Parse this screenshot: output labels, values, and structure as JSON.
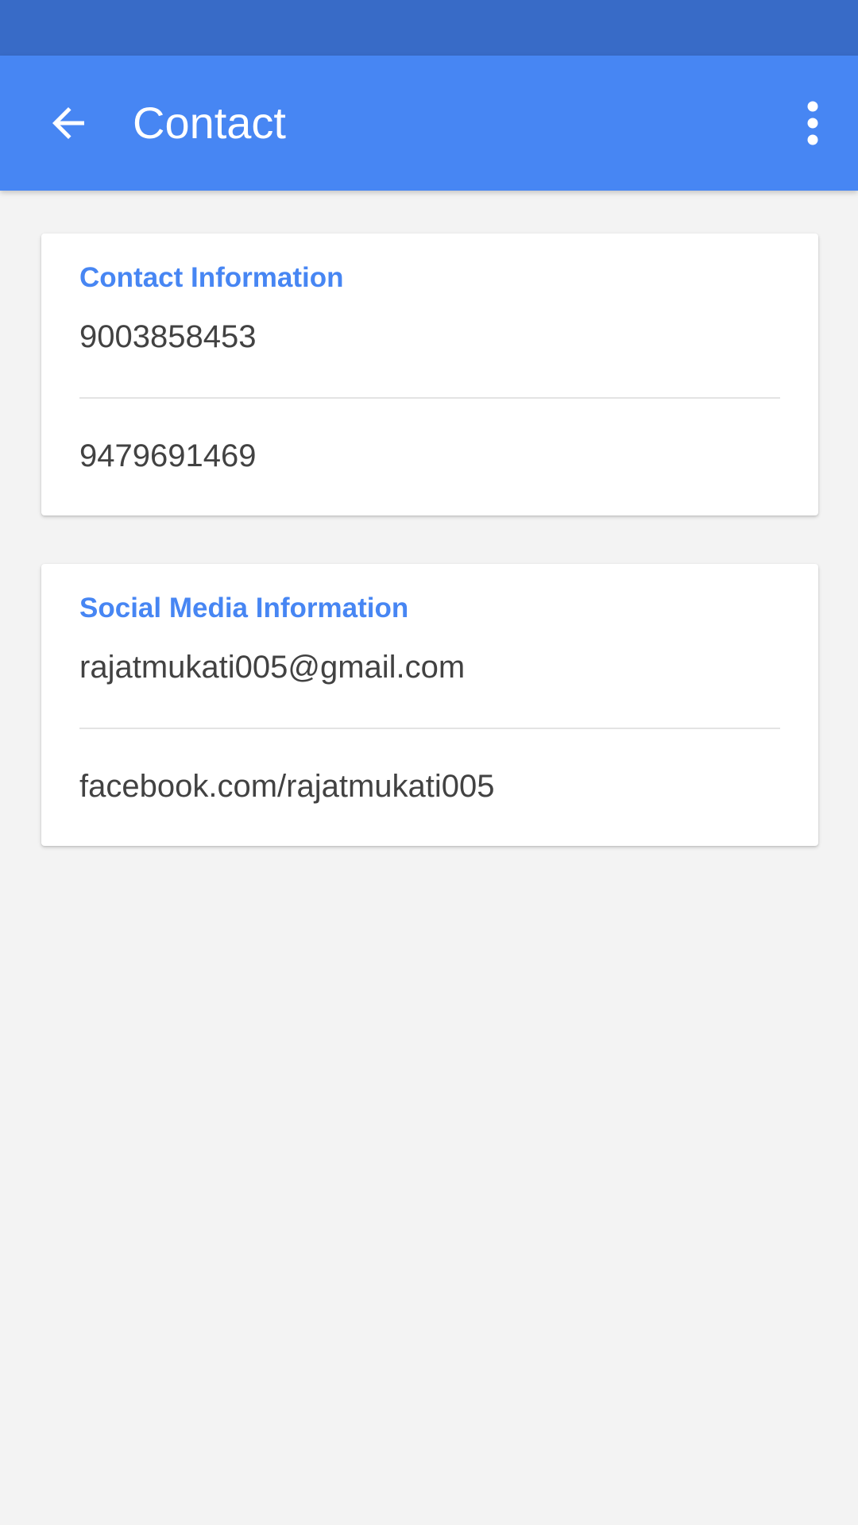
{
  "app_bar": {
    "title": "Contact",
    "back_icon": "arrow-back-icon",
    "overflow_icon": "more-vert-icon",
    "color": "#4786f3",
    "status_bar_color": "#386bc7"
  },
  "contact_card": {
    "heading": "Contact Information",
    "phone_1": "9003858453",
    "phone_2": "9479691469"
  },
  "social_card": {
    "heading": "Social Media Information",
    "email": "rajatmukati005@gmail.com",
    "facebook": "facebook.com/rajatmukati005"
  },
  "accent_color": "#4786f3"
}
